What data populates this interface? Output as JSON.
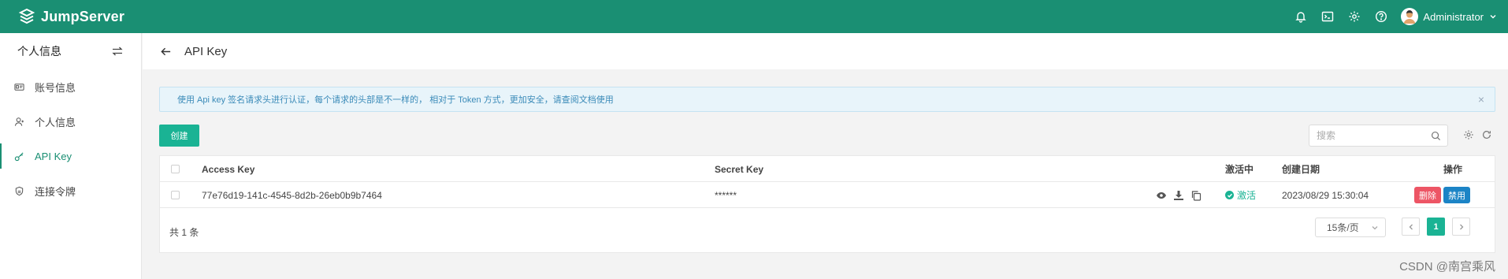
{
  "app": {
    "brand": "JumpServer",
    "user_name": "Administrator"
  },
  "sidebar": {
    "title": "个人信息",
    "items": [
      {
        "label": "账号信息",
        "icon": "id-card-icon"
      },
      {
        "label": "个人信息",
        "icon": "user-icon"
      },
      {
        "label": "API Key",
        "icon": "key-icon",
        "active": true
      },
      {
        "label": "连接令牌",
        "icon": "shield-icon"
      }
    ]
  },
  "page": {
    "title": "API Key"
  },
  "alert": {
    "text": "使用 Api key 签名请求头进行认证，每个请求的头部是不一样的， 相对于 Token 方式，更加安全，请查阅文档使用"
  },
  "toolbar": {
    "create_label": "创建",
    "search_placeholder": "搜索"
  },
  "table": {
    "columns": [
      "Access Key",
      "Secret Key",
      "激活中",
      "创建日期",
      "操作"
    ],
    "rows": [
      {
        "access_key": "77e76d19-141c-4545-8d2b-26eb0b9b7464",
        "secret_key": "******",
        "status": "激活",
        "created": "2023/08/29 15:30:04",
        "delete_label": "删除",
        "disable_label": "禁用"
      }
    ]
  },
  "pagination": {
    "total": "共 1 条",
    "page_size": "15条/页",
    "current_page": "1"
  },
  "watermark": "CSDN @南宫乘风",
  "colors": {
    "topbar": "#1a8f73",
    "primary": "#1ab394",
    "danger": "#ed5565",
    "info": "#1c84c6"
  }
}
